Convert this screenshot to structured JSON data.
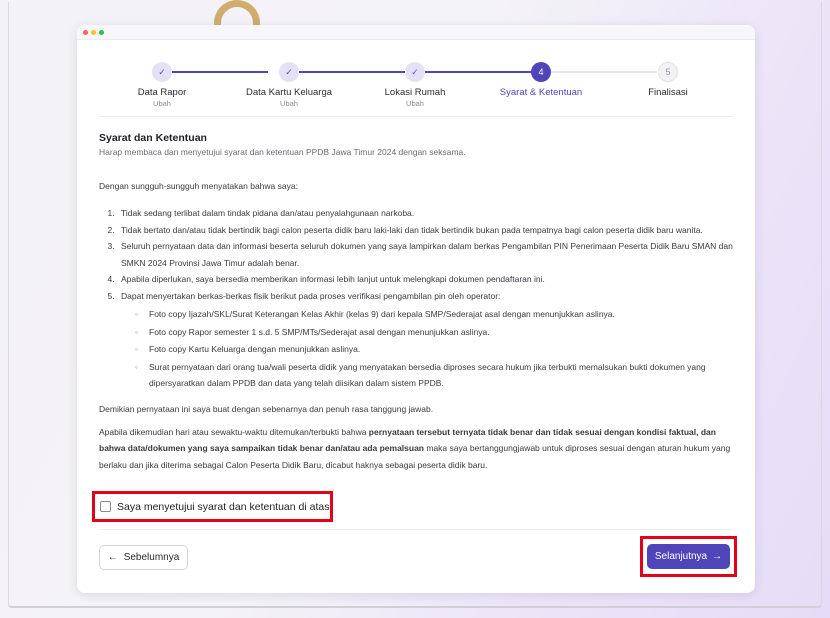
{
  "colors": {
    "accent": "#4f45b8",
    "accent_light": "#e4e1f7",
    "highlight": "#e2001a",
    "pending_line": "#e6e6ec"
  },
  "stepper": {
    "steps": [
      {
        "number": "✓",
        "title": "Data Rapor",
        "subtitle": "Ubah",
        "state": "done"
      },
      {
        "number": "✓",
        "title": "Data Kartu Keluarga",
        "subtitle": "Ubah",
        "state": "done"
      },
      {
        "number": "✓",
        "title": "Lokasi Rumah",
        "subtitle": "Ubah",
        "state": "done"
      },
      {
        "number": "4",
        "title": "Syarat & Ketentuan",
        "subtitle": "",
        "state": "active"
      },
      {
        "number": "5",
        "title": "Finalisasi",
        "subtitle": "",
        "state": "pending"
      }
    ]
  },
  "section": {
    "title": "Syarat dan Ketentuan",
    "subtitle": "Harap membaca dan menyetujui syarat dan ketentuan PPDB Jawa Timur 2024 dengan seksama."
  },
  "body": {
    "intro": "Dengan sungguh-sungguh menyatakan bahwa saya:",
    "items": [
      "Tidak sedang terlibat dalam tindak pidana dan/atau penyalahgunaan narkoba.",
      "Tidak bertato dan/atau tidak bertindik bagi calon peserta didik baru laki-laki dan tidak bertindik bukan pada tempatnya bagi calon peserta didik baru wanita.",
      "Seluruh pernyataan data dan informasi beserta seluruh dokumen yang saya lampirkan dalam berkas Pengambilan PIN Penerimaan Peserta Didik Baru SMAN dan SMKN 2024 Provinsi Jawa Timur adalah benar.",
      "Apabila diperlukan, saya bersedia memberikan informasi lebih lanjut untuk melengkapi dokumen pendaftaran ini.",
      "Dapat menyertakan berkas-berkas fisik berikut pada proses verifikasi pengambilan pin oleh operator:"
    ],
    "sub_items": [
      "Foto copy Ijazah/SKL/Surat Keterangan Kelas Akhir (kelas 9) dari kepala SMP/Sederajat asal dengan menunjukkan aslinya.",
      "Foto copy Rapor semester 1 s.d. 5 SMP/MTs/Sederajat asal dengan menunjukkan aslinya.",
      "Foto copy Kartu Keluarga dengan menunjukkan aslinya.",
      "Surat pernyataan dari orang tua/wali peserta didik yang menyatakan bersedia diproses secara hukum jika terbukti memalsukan bukti dokumen yang dipersyaratkan dalam PPDB dan data yang telah diisikan dalam sistem PPDB."
    ],
    "closing": "Demikian pernyataan ini saya buat dengan sebenarnya dan penuh rasa tanggung jawab.",
    "final_prefix": "Apabila dikemudian hari atau sewaktu-waktu ditemukan/terbukti bahwa ",
    "final_bold_1": "pernyataan tersebut ternyata tidak benar dan tidak sesuai dengan kondisi faktual, dan bahwa data/dokumen yang saya sampaikan tidak benar dan/atau ada pemalsuan",
    "final_suffix": " maka saya bertanggungjawab untuk diproses sesuai dengan aturan hukum yang berlaku dan jika diterima sebagai Calon Peserta Didik Baru, dicabut haknya sebagai peserta didik baru."
  },
  "agreement": {
    "label": "Saya menyetujui syarat dan ketentuan di atas",
    "checked": false
  },
  "nav": {
    "prev_label": "Sebelumnya",
    "prev_icon": "arrow-left-icon",
    "next_label": "Selanjutnya",
    "next_icon": "arrow-right-icon"
  }
}
